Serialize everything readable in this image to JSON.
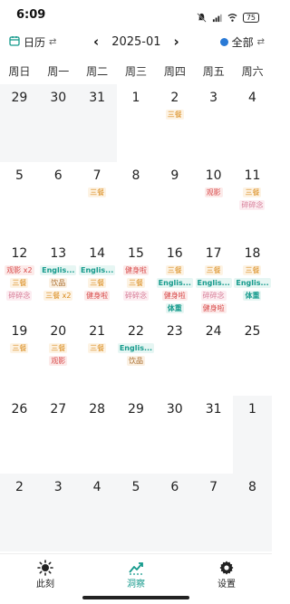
{
  "status": {
    "time": "6:09",
    "battery": "75"
  },
  "toolbar": {
    "left_label": "日历",
    "month": "2025-01",
    "right_label": "全部"
  },
  "weekdays": [
    "周日",
    "周一",
    "周二",
    "周三",
    "周四",
    "周五",
    "周六"
  ],
  "weeks": [
    [
      {
        "day": "29",
        "other": true,
        "events": []
      },
      {
        "day": "30",
        "other": true,
        "events": []
      },
      {
        "day": "31",
        "other": true,
        "events": []
      },
      {
        "day": "1",
        "events": []
      },
      {
        "day": "2",
        "events": [
          {
            "t": "三餐",
            "c": "orange"
          }
        ]
      },
      {
        "day": "3",
        "events": []
      },
      {
        "day": "4",
        "events": []
      }
    ],
    [
      {
        "day": "5",
        "events": []
      },
      {
        "day": "6",
        "events": []
      },
      {
        "day": "7",
        "events": [
          {
            "t": "三餐",
            "c": "orange"
          }
        ]
      },
      {
        "day": "8",
        "events": []
      },
      {
        "day": "9",
        "events": []
      },
      {
        "day": "10",
        "events": [
          {
            "t": "观影",
            "c": "red"
          }
        ]
      },
      {
        "day": "11",
        "events": [
          {
            "t": "三餐",
            "c": "orange"
          },
          {
            "t": "碎碎念",
            "c": "pink"
          }
        ]
      }
    ],
    [
      {
        "day": "12",
        "events": [
          {
            "t": "观影 x2",
            "c": "red"
          },
          {
            "t": "三餐",
            "c": "orange"
          },
          {
            "t": "碎碎念",
            "c": "pink"
          }
        ]
      },
      {
        "day": "13",
        "events": [
          {
            "t": "Englis...",
            "c": "teal"
          },
          {
            "t": "饮品",
            "c": "brown"
          },
          {
            "t": "三餐 x2",
            "c": "orange"
          }
        ]
      },
      {
        "day": "14",
        "events": [
          {
            "t": "Englis...",
            "c": "teal"
          },
          {
            "t": "三餐",
            "c": "orange"
          },
          {
            "t": "健身啦",
            "c": "red"
          }
        ]
      },
      {
        "day": "15",
        "events": [
          {
            "t": "健身啦",
            "c": "red"
          },
          {
            "t": "三餐",
            "c": "orange"
          },
          {
            "t": "碎碎念",
            "c": "pink"
          }
        ]
      },
      {
        "day": "16",
        "events": [
          {
            "t": "三餐",
            "c": "orange"
          },
          {
            "t": "Englis...",
            "c": "teal"
          },
          {
            "t": "健身啦",
            "c": "red"
          },
          {
            "t": "体重",
            "c": "teal"
          }
        ]
      },
      {
        "day": "17",
        "events": [
          {
            "t": "三餐",
            "c": "orange"
          },
          {
            "t": "Englis...",
            "c": "teal"
          },
          {
            "t": "碎碎念",
            "c": "pink"
          },
          {
            "t": "健身啦",
            "c": "red"
          }
        ]
      },
      {
        "day": "18",
        "events": [
          {
            "t": "三餐",
            "c": "orange"
          },
          {
            "t": "Englis...",
            "c": "teal"
          },
          {
            "t": "体重",
            "c": "teal"
          }
        ]
      }
    ],
    [
      {
        "day": "19",
        "events": [
          {
            "t": "三餐",
            "c": "orange"
          }
        ]
      },
      {
        "day": "20",
        "events": [
          {
            "t": "三餐",
            "c": "orange"
          },
          {
            "t": "观影",
            "c": "red"
          }
        ]
      },
      {
        "day": "21",
        "events": [
          {
            "t": "三餐",
            "c": "orange"
          }
        ]
      },
      {
        "day": "22",
        "events": [
          {
            "t": "Englis...",
            "c": "teal"
          },
          {
            "t": "饮品",
            "c": "brown"
          }
        ]
      },
      {
        "day": "23",
        "events": []
      },
      {
        "day": "24",
        "events": []
      },
      {
        "day": "25",
        "events": []
      }
    ],
    [
      {
        "day": "26",
        "events": []
      },
      {
        "day": "27",
        "events": []
      },
      {
        "day": "28",
        "events": []
      },
      {
        "day": "29",
        "events": []
      },
      {
        "day": "30",
        "events": []
      },
      {
        "day": "31",
        "events": []
      },
      {
        "day": "1",
        "other": true,
        "events": []
      }
    ],
    [
      {
        "day": "2",
        "other": true,
        "events": []
      },
      {
        "day": "3",
        "other": true,
        "events": []
      },
      {
        "day": "4",
        "other": true,
        "events": []
      },
      {
        "day": "5",
        "other": true,
        "events": []
      },
      {
        "day": "6",
        "other": true,
        "events": []
      },
      {
        "day": "7",
        "other": true,
        "events": []
      },
      {
        "day": "8",
        "other": true,
        "events": []
      }
    ]
  ],
  "nav": [
    {
      "label": "此刻",
      "icon": "sun-icon",
      "active": false
    },
    {
      "label": "洞察",
      "icon": "trend-icon",
      "active": true
    },
    {
      "label": "设置",
      "icon": "gear-icon",
      "active": false
    }
  ],
  "colors": {
    "accent": "#159a8c",
    "orange": "#d98a1a",
    "red": "#d84a4a",
    "pink": "#d67b96",
    "brown": "#a86b2a"
  }
}
